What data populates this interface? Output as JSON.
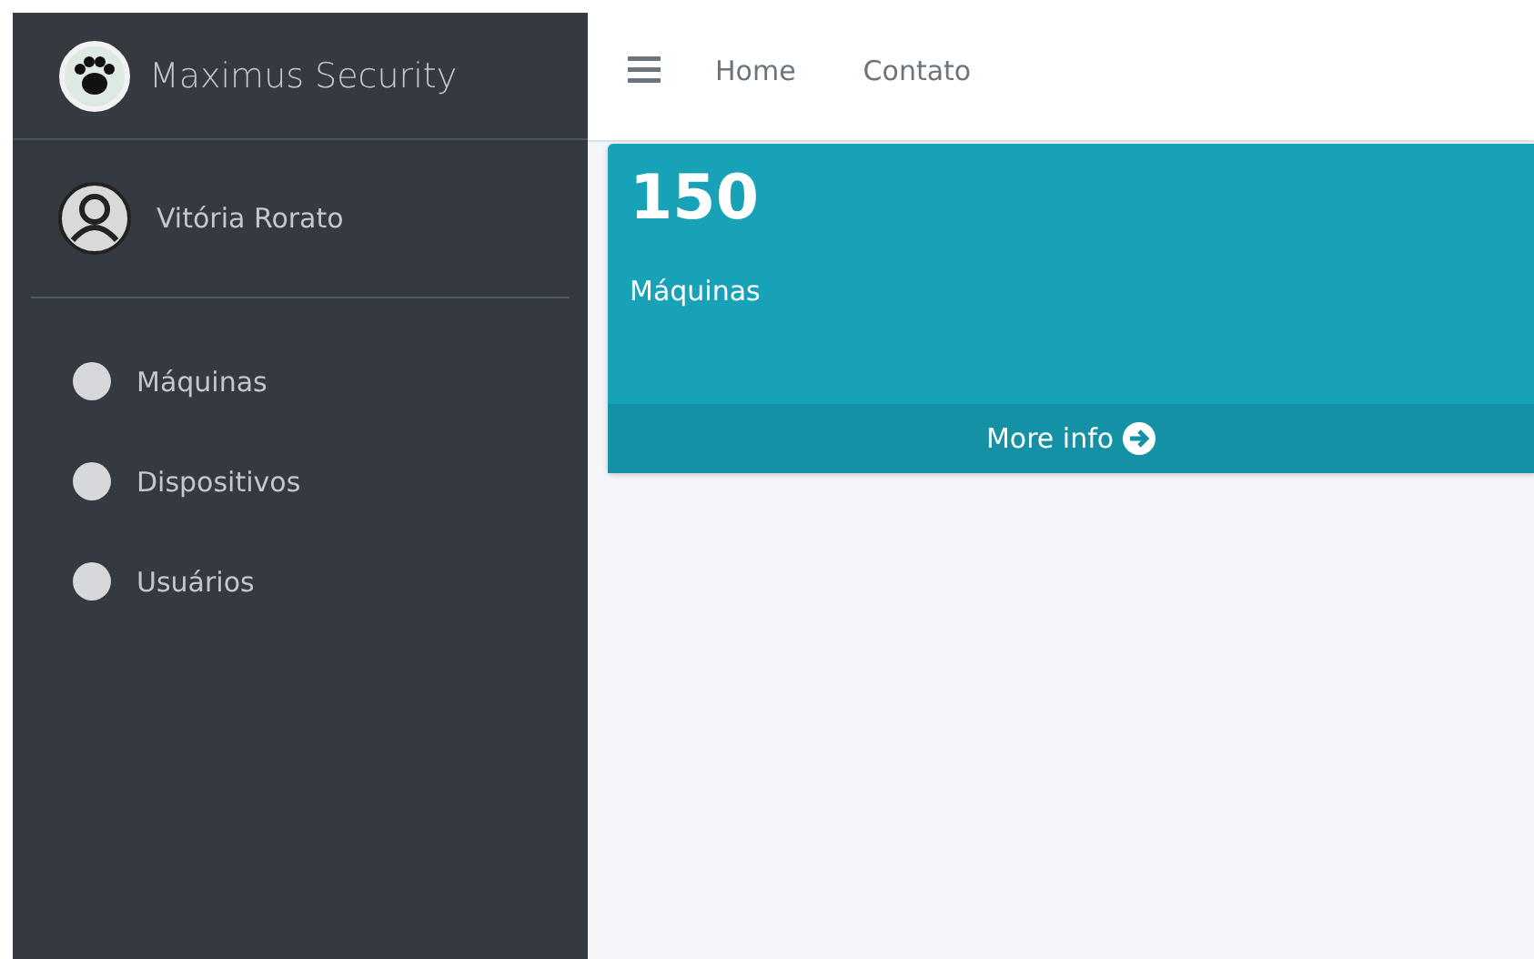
{
  "brand": {
    "title": "Maximus Security"
  },
  "user": {
    "name": "Vitória Rorato"
  },
  "sidebar": {
    "items": [
      {
        "label": "Máquinas"
      },
      {
        "label": "Dispositivos"
      },
      {
        "label": "Usuários"
      }
    ]
  },
  "navbar": {
    "links": [
      "Home",
      "Contato"
    ]
  },
  "card": {
    "value": "150",
    "label": "Máquinas",
    "footer": "More info"
  }
}
